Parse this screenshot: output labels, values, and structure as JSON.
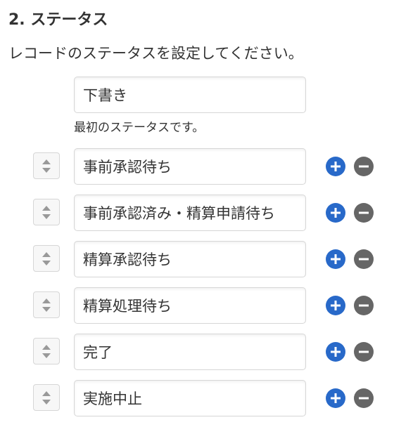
{
  "section": {
    "title": "2. ステータス",
    "description": "レコードのステータスを設定してください。"
  },
  "initial_status": {
    "value": "下書き",
    "hint": "最初のステータスです。"
  },
  "statuses": [
    {
      "value": "事前承認待ち"
    },
    {
      "value": "事前承認済み・精算申請待ち"
    },
    {
      "value": "精算承認待ち"
    },
    {
      "value": "精算処理待ち"
    },
    {
      "value": "完了"
    },
    {
      "value": "実施中止"
    }
  ],
  "icons": {
    "drag_handle": "up-down-arrows-icon",
    "add": "plus-icon",
    "remove": "minus-icon"
  },
  "colors": {
    "add_button": "#2869c9",
    "remove_button": "#666666",
    "text": "#333333",
    "border": "#d6d6d6"
  }
}
